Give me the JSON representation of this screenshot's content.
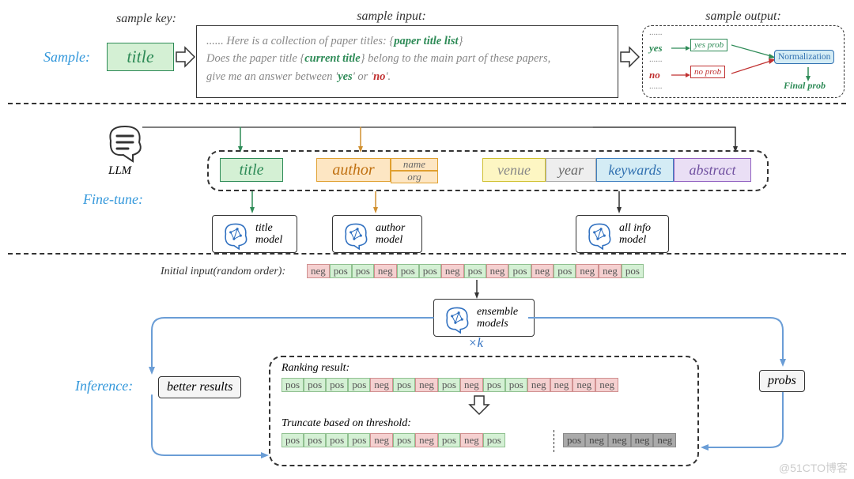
{
  "labels": {
    "sample": "Sample:",
    "finetune": "Fine-tune:",
    "inference": "Inference:",
    "sample_key": "sample key:",
    "sample_input": "sample input:",
    "sample_output": "sample output:"
  },
  "sample": {
    "key": "title",
    "input_line1_prefix": "...... Here is a collection of paper titles: {",
    "input_line1_var": "paper title list",
    "input_line1_suffix": "}",
    "input_line2_prefix": "Does the paper title {",
    "input_line2_var": "current title",
    "input_line2_suffix": "} belong to the main part of these papers,",
    "input_line3_a": "give me an answer between '",
    "input_line3_yes": "yes",
    "input_line3_mid": "' or '",
    "input_line3_no": "no",
    "input_line3_b": "'."
  },
  "output": {
    "dots": "......",
    "yes": "yes",
    "no": "no",
    "yes_prob": "yes prob",
    "no_prob": "no prob",
    "norm": "Normalization",
    "final": "Final prob"
  },
  "finetune": {
    "llm": "LLM",
    "title": "title",
    "author": "author",
    "name": "name",
    "org": "org",
    "venue": "venue",
    "year": "year",
    "keywards": "keywards",
    "abstract": "abstract",
    "title_model": "title model",
    "author_model": "author model",
    "all_info_model": "all info model"
  },
  "inference": {
    "initial_label": "Initial input(random order):",
    "initial_seq": [
      "neg",
      "pos",
      "pos",
      "neg",
      "pos",
      "pos",
      "neg",
      "pos",
      "neg",
      "pos",
      "neg",
      "pos",
      "neg",
      "neg",
      "pos"
    ],
    "ensemble": "ensemble models",
    "times_k": "×k",
    "probs": "probs",
    "better": "better results",
    "ranking_label": "Ranking result:",
    "ranking_seq": [
      "pos",
      "pos",
      "pos",
      "pos",
      "neg",
      "pos",
      "neg",
      "pos",
      "neg",
      "pos",
      "pos",
      "neg",
      "neg",
      "neg",
      "neg"
    ],
    "truncate_label": "Truncate based on threshold:",
    "truncate_keep": [
      "pos",
      "pos",
      "pos",
      "pos",
      "neg",
      "pos",
      "neg",
      "pos",
      "neg",
      "pos"
    ],
    "truncate_drop": [
      "pos",
      "neg",
      "neg",
      "neg",
      "neg"
    ]
  },
  "watermark": "@51CTO博客"
}
